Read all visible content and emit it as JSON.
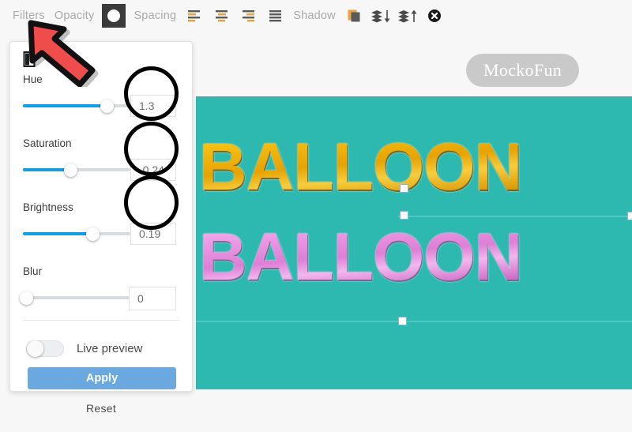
{
  "toolbar": {
    "filters_label": "Filters",
    "opacity_label": "Opacity",
    "spacing_label": "Spacing",
    "shadow_label": "Shadow",
    "icons": [
      {
        "name": "opacity-swatch",
        "label": "opacity-circle-icon"
      },
      {
        "name": "align-left-icon",
        "label": "align-left"
      },
      {
        "name": "align-center-icon",
        "label": "align-center"
      },
      {
        "name": "align-right-icon",
        "label": "align-right"
      },
      {
        "name": "align-justify-icon",
        "label": "align-justify"
      },
      {
        "name": "duplicate-icon",
        "label": "duplicate"
      },
      {
        "name": "layer-down-icon",
        "label": "send-backward"
      },
      {
        "name": "layer-up-icon",
        "label": "bring-forward"
      },
      {
        "name": "delete-icon",
        "label": "delete"
      }
    ]
  },
  "panel": {
    "title_icon": "contrast-icon",
    "controls": [
      {
        "label": "Hue",
        "value": "1.3",
        "fill_pct": 78,
        "thumb_pct": 78
      },
      {
        "label": "Saturation",
        "value": "-0.24",
        "fill_pct": 44,
        "thumb_pct": 44
      },
      {
        "label": "Brightness",
        "value": "0.19",
        "fill_pct": 64,
        "thumb_pct": 64
      },
      {
        "label": "Blur",
        "value": "0",
        "fill_pct": 0,
        "thumb_pct": 0
      }
    ],
    "live_preview_label": "Live preview",
    "live_preview_on": false,
    "apply_label": "Apply",
    "reset_label": "Reset"
  },
  "canvas": {
    "background_color": "#2db8b0",
    "text_top": "BALLOON",
    "text_bottom": "BALLOON",
    "logo_badge": "MockoFun"
  },
  "annotations": {
    "arrow_color": "#ef4c4c",
    "circle_color": "#000000",
    "circled_values": [
      "1.3",
      "-0.24",
      "0.19"
    ]
  },
  "colors": {
    "accent_blue": "#0e9fe8",
    "apply_blue": "#69a9e0",
    "canvas_teal": "#2db8b0",
    "toolbar_text": "#a9a9a9",
    "gold": "#f2b705",
    "pink": "#e58fe0"
  }
}
